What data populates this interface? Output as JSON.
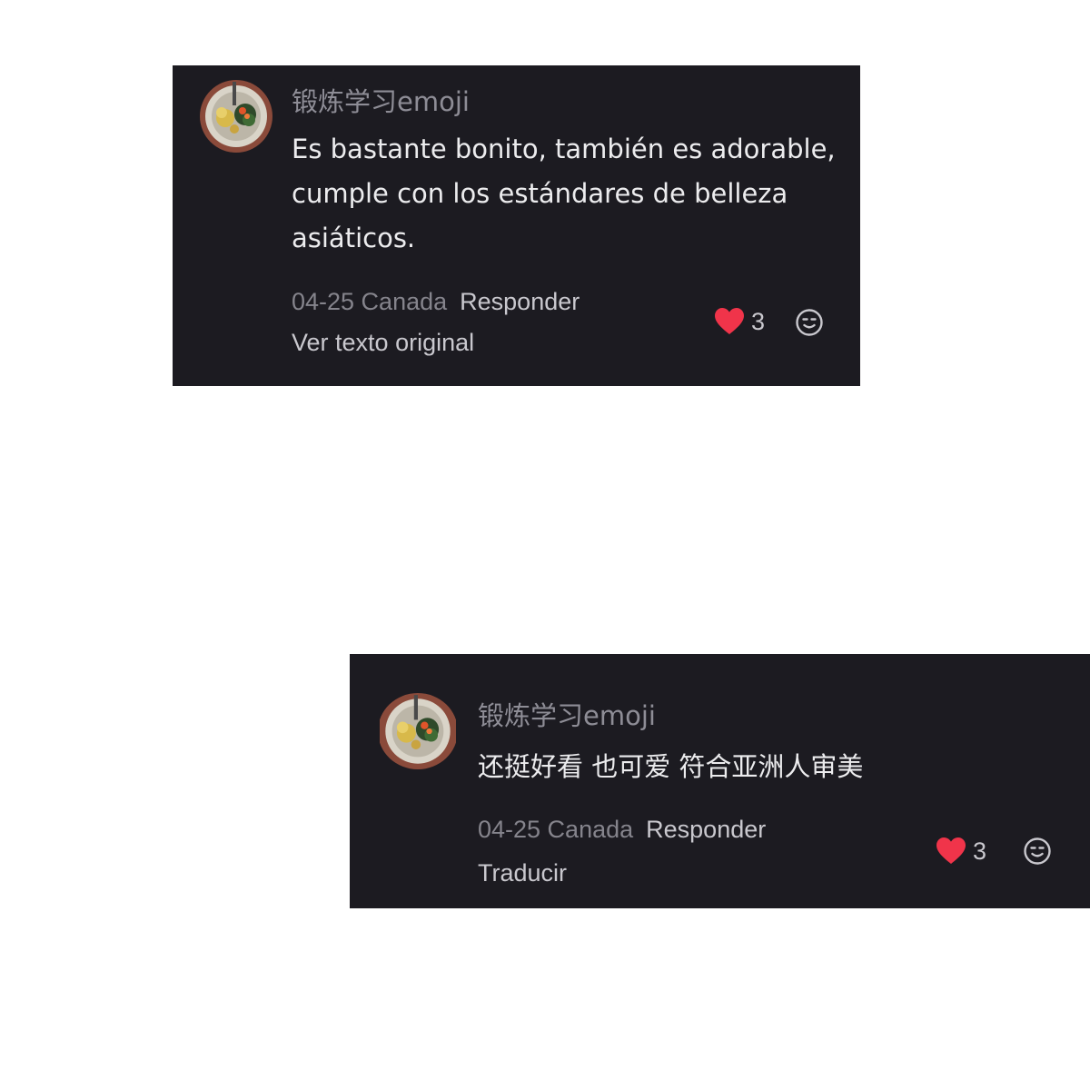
{
  "comments": [
    {
      "username": "锻炼学习emoji",
      "text": "Es bastante bonito, también es adorable, cumple con los estándares de belleza asiáticos.",
      "date_location": "04-25 Canada",
      "reply_label": "Responder",
      "translation_action": "Ver texto original",
      "like_count": "3",
      "avatar_icon": "food-plate-avatar",
      "like_icon": "heart-icon",
      "emoji_icon": "smiley-icon"
    },
    {
      "username": "锻炼学习emoji",
      "text": "还挺好看 也可爱 符合亚洲人审美",
      "date_location": "04-25 Canada",
      "reply_label": "Responder",
      "translation_action": "Traducir",
      "like_count": "3",
      "avatar_icon": "food-plate-avatar",
      "like_icon": "heart-icon",
      "emoji_icon": "smiley-icon"
    }
  ],
  "colors": {
    "card_background": "#1c1b21",
    "page_background": "#ffffff",
    "heart": "#f0344a",
    "username": "#8e8d96",
    "comment_text": "#ececee"
  }
}
